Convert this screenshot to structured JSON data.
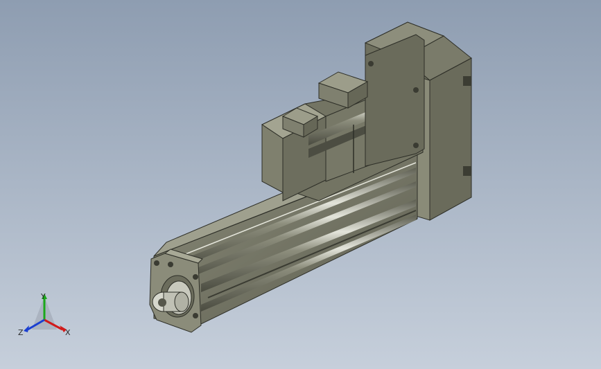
{
  "viewport": {
    "background_top": "#8e9db1",
    "background_bottom": "#c6cfdb"
  },
  "model": {
    "body_color": "#7c7d6c",
    "highlight_color": "#cfd0c4",
    "shadow_color": "#3f4036"
  },
  "triad": {
    "x_label": "X",
    "y_label": "Y",
    "z_label": "Z",
    "x_color": "#d11a1a",
    "y_color": "#1aa81a",
    "z_color": "#1a3fd1"
  }
}
